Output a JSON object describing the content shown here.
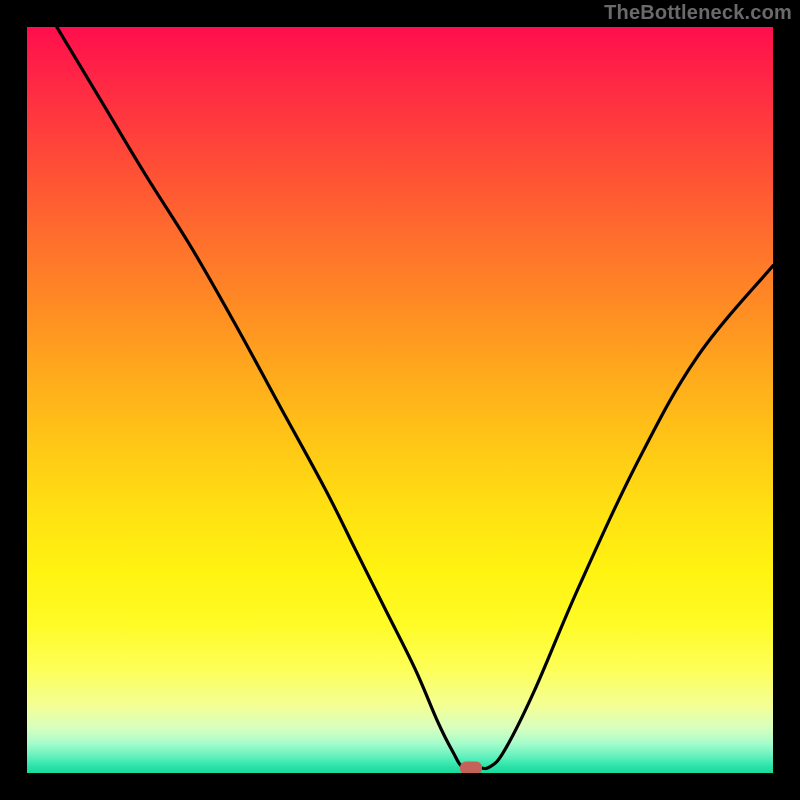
{
  "watermark": {
    "text": "TheBottleneck.com"
  },
  "chart_data": {
    "type": "line",
    "title": "",
    "xlabel": "",
    "ylabel": "",
    "xlim": [
      0,
      100
    ],
    "ylim": [
      0,
      100
    ],
    "grid": false,
    "legend": false,
    "background": "vertical gradient red→orange→yellow→green (top→bottom)",
    "gradient_stops": [
      {
        "pos": 0,
        "color": "#ff0e4d"
      },
      {
        "pos": 0.5,
        "color": "#ffc716"
      },
      {
        "pos": 0.8,
        "color": "#fffb26"
      },
      {
        "pos": 1.0,
        "color": "#19db9d"
      }
    ],
    "series": [
      {
        "name": "bottleneck-curve",
        "color": "#000000",
        "x": [
          4.0,
          10,
          16,
          22,
          28,
          34,
          40,
          44,
          48,
          52,
          55,
          57,
          58.5,
          60.5,
          62,
          64,
          68,
          74,
          82,
          90,
          100
        ],
        "y": [
          100,
          90,
          80,
          70.5,
          60,
          49,
          38,
          30,
          22,
          14,
          7,
          3,
          0.7,
          0.7,
          0.8,
          3,
          11,
          25,
          42,
          56,
          68
        ]
      }
    ],
    "marker": {
      "name": "optimal-point",
      "x": 59.5,
      "y": 0.7,
      "shape": "rounded-rect",
      "color": "#c46159"
    },
    "note": "y is percent bottleneck (0 at bottom = no bottleneck / green)"
  }
}
